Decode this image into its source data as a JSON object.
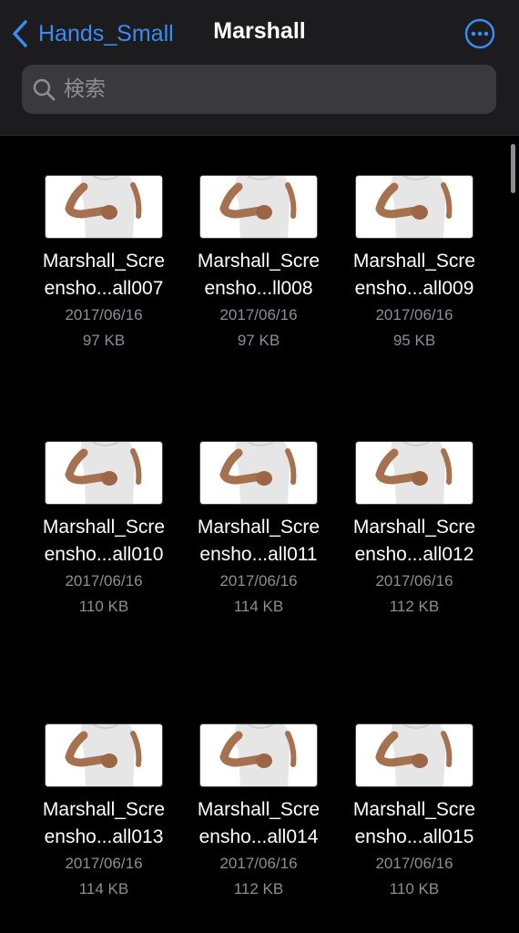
{
  "header": {
    "back_label": "Hands_Small",
    "title": "Marshall",
    "more_icon": "ellipsis-circle-icon",
    "accent_color": "#3a8cf5"
  },
  "search": {
    "placeholder": "検索",
    "value": ""
  },
  "files": [
    {
      "name1": "Marshall_Scre",
      "name2": "ensho...all007",
      "date": "2017/06/16",
      "size": "97 KB"
    },
    {
      "name1": "Marshall_Scre",
      "name2": "ensho...ll008",
      "date": "2017/06/16",
      "size": "97 KB"
    },
    {
      "name1": "Marshall_Scre",
      "name2": "ensho...all009",
      "date": "2017/06/16",
      "size": "95 KB"
    },
    {
      "name1": "Marshall_Scre",
      "name2": "ensho...all010",
      "date": "2017/06/16",
      "size": "110 KB"
    },
    {
      "name1": "Marshall_Scre",
      "name2": "ensho...all011",
      "date": "2017/06/16",
      "size": "114 KB"
    },
    {
      "name1": "Marshall_Scre",
      "name2": "ensho...all012",
      "date": "2017/06/16",
      "size": "112 KB"
    },
    {
      "name1": "Marshall_Scre",
      "name2": "ensho...all013",
      "date": "2017/06/16",
      "size": "114 KB"
    },
    {
      "name1": "Marshall_Scre",
      "name2": "ensho...all014",
      "date": "2017/06/16",
      "size": "112 KB"
    },
    {
      "name1": "Marshall_Scre",
      "name2": "ensho...all015",
      "date": "2017/06/16",
      "size": "110 KB"
    }
  ]
}
